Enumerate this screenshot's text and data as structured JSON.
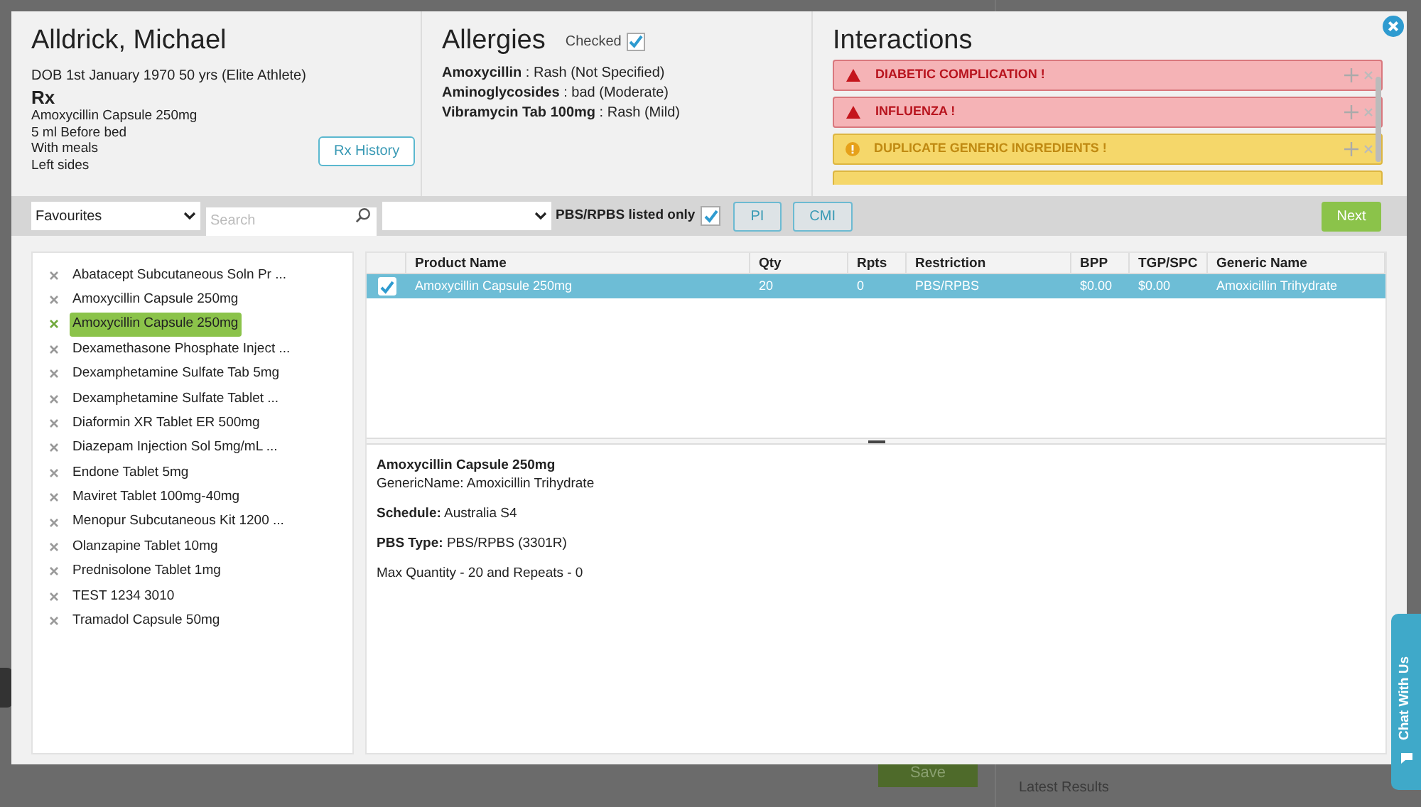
{
  "background": {
    "save_button": "Save",
    "latest_results": "Latest Results",
    "chat_tab": "Chat With Us"
  },
  "patient": {
    "name": "Alldrick, Michael",
    "dob": "DOB 1st January 1970 50 yrs (Elite Athlete)",
    "rx_heading": "Rx",
    "rx_lines": [
      "Amoxycillin Capsule 250mg",
      "5 ml Before bed",
      "With meals",
      "Left sides"
    ],
    "rx_history_button": "Rx History"
  },
  "allergies": {
    "title": "Allergies",
    "checked_label": "Checked",
    "checked": true,
    "items": [
      {
        "name": "Amoxycillin",
        "reaction": " : Rash (Not Specified)"
      },
      {
        "name": "Aminoglycosides",
        "reaction": " : bad (Moderate)"
      },
      {
        "name": "Vibramycin Tab 100mg",
        "reaction": " : Rash (Mild)"
      }
    ]
  },
  "interactions": {
    "title": "Interactions",
    "items": [
      {
        "kind": "danger",
        "title": "DIABETIC COMPLICATION !"
      },
      {
        "kind": "danger",
        "title": "INFLUENZA !"
      },
      {
        "kind": "warning",
        "title": "DUPLICATE GENERIC INGREDIENTS !"
      },
      {
        "kind": "warning"
      }
    ]
  },
  "toolbar": {
    "list_select": "Favourites",
    "search_placeholder": "Search",
    "pbs_label": "PBS/RPBS listed only",
    "pbs_checked": true,
    "buttons": [
      "PI",
      "CMI"
    ],
    "next_button": "Next"
  },
  "favourites": [
    {
      "label": "Abatacept Subcutaneous Soln Pr ...",
      "selected": false
    },
    {
      "label": "Amoxycillin Capsule 250mg",
      "selected": false
    },
    {
      "label": "Amoxycillin Capsule 250mg",
      "selected": true
    },
    {
      "label": "Dexamethasone Phosphate Inject ...",
      "selected": false
    },
    {
      "label": "Dexamphetamine Sulfate Tab 5mg",
      "selected": false
    },
    {
      "label": "Dexamphetamine Sulfate Tablet ...",
      "selected": false
    },
    {
      "label": "Diaformin XR Tablet ER 500mg",
      "selected": false
    },
    {
      "label": "Diazepam Injection Sol 5mg/mL ...",
      "selected": false
    },
    {
      "label": "Endone Tablet 5mg",
      "selected": false
    },
    {
      "label": "Maviret Tablet 100mg-40mg",
      "selected": false
    },
    {
      "label": "Menopur Subcutaneous Kit 1200 ...",
      "selected": false
    },
    {
      "label": "Olanzapine Tablet 10mg",
      "selected": false
    },
    {
      "label": "Prednisolone Tablet 1mg",
      "selected": false
    },
    {
      "label": "TEST 1234 3010",
      "selected": false
    },
    {
      "label": "Tramadol Capsule 50mg",
      "selected": false
    }
  ],
  "table": {
    "columns": [
      "Product Name",
      "Qty",
      "Rpts",
      "Restriction",
      "BPP",
      "TGP/SPC",
      "Generic Name"
    ],
    "rows": [
      {
        "checked": true,
        "selected": true,
        "cells": [
          "Amoxycillin Capsule 250mg",
          "20",
          "0",
          "PBS/RPBS",
          "$0.00",
          "$0.00",
          "Amoxicillin Trihydrate"
        ]
      }
    ]
  },
  "detail": {
    "title": "Amoxycillin Capsule 250mg",
    "generic": "GenericName: Amoxicillin Trihydrate",
    "schedule": "**Schedule:** Australia S4",
    "pbs_type": "**PBS Type:** PBS/RPBS (3301R)",
    "max_quantity": "Max Quantity - 20 and Repeats - 0"
  }
}
